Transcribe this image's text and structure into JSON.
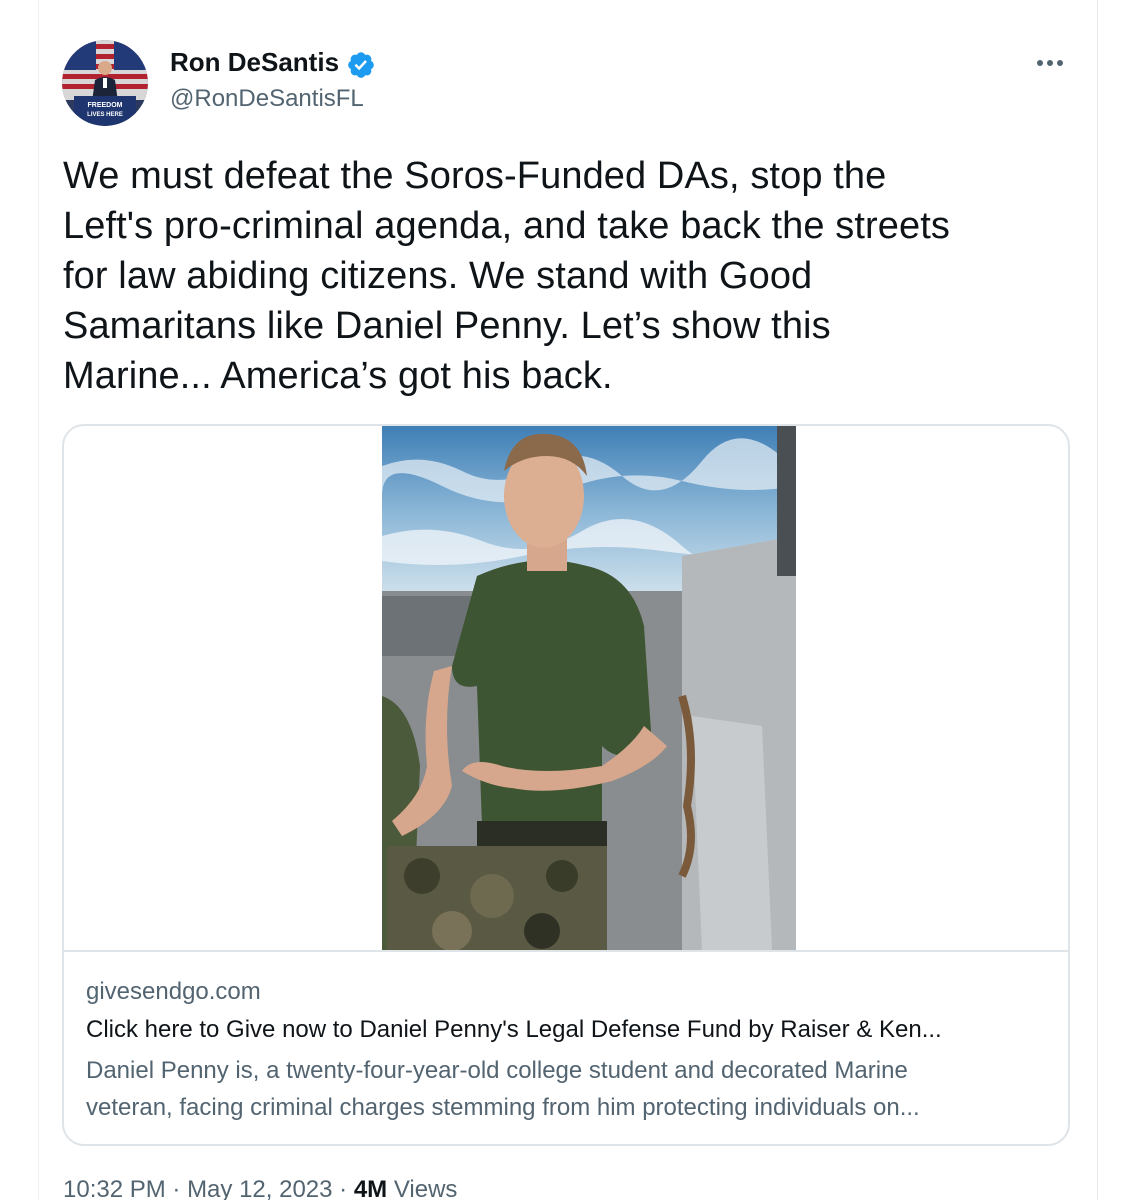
{
  "tweet": {
    "author": {
      "display_name": "Ron DeSantis",
      "handle": "@RonDeSantisFL",
      "verified": true,
      "avatar_banner_text_1": "FREEDOM",
      "avatar_banner_text_2": "LIVES HERE"
    },
    "text": "We must defeat the Soros-Funded DAs, stop the\nLeft's pro-criminal agenda, and take back the streets\nfor law abiding citizens. We stand with Good\nSamaritans like Daniel Penny. Let’s show this\nMarine... America’s got his back.",
    "card": {
      "domain": "givesendgo.com",
      "title": "Click here to Give now to Daniel Penny's Legal Defense Fund by Raiser & Ken...",
      "description": "Daniel Penny is, a twenty-four-year-old college student and decorated Marine\nveteran, facing criminal charges stemming from him protecting individuals on..."
    },
    "meta": {
      "time": "10:32 PM",
      "separator": " · ",
      "date": "May 12, 2023",
      "views_count": "4M",
      "views_label": " Views"
    }
  },
  "colors": {
    "text_primary": "#0f1419",
    "text_secondary": "#536471",
    "verified_blue": "#1d9bf0",
    "border": "#dfe4e8"
  },
  "icons": {
    "verified": "verified-badge-icon",
    "more": "more-options-icon"
  }
}
